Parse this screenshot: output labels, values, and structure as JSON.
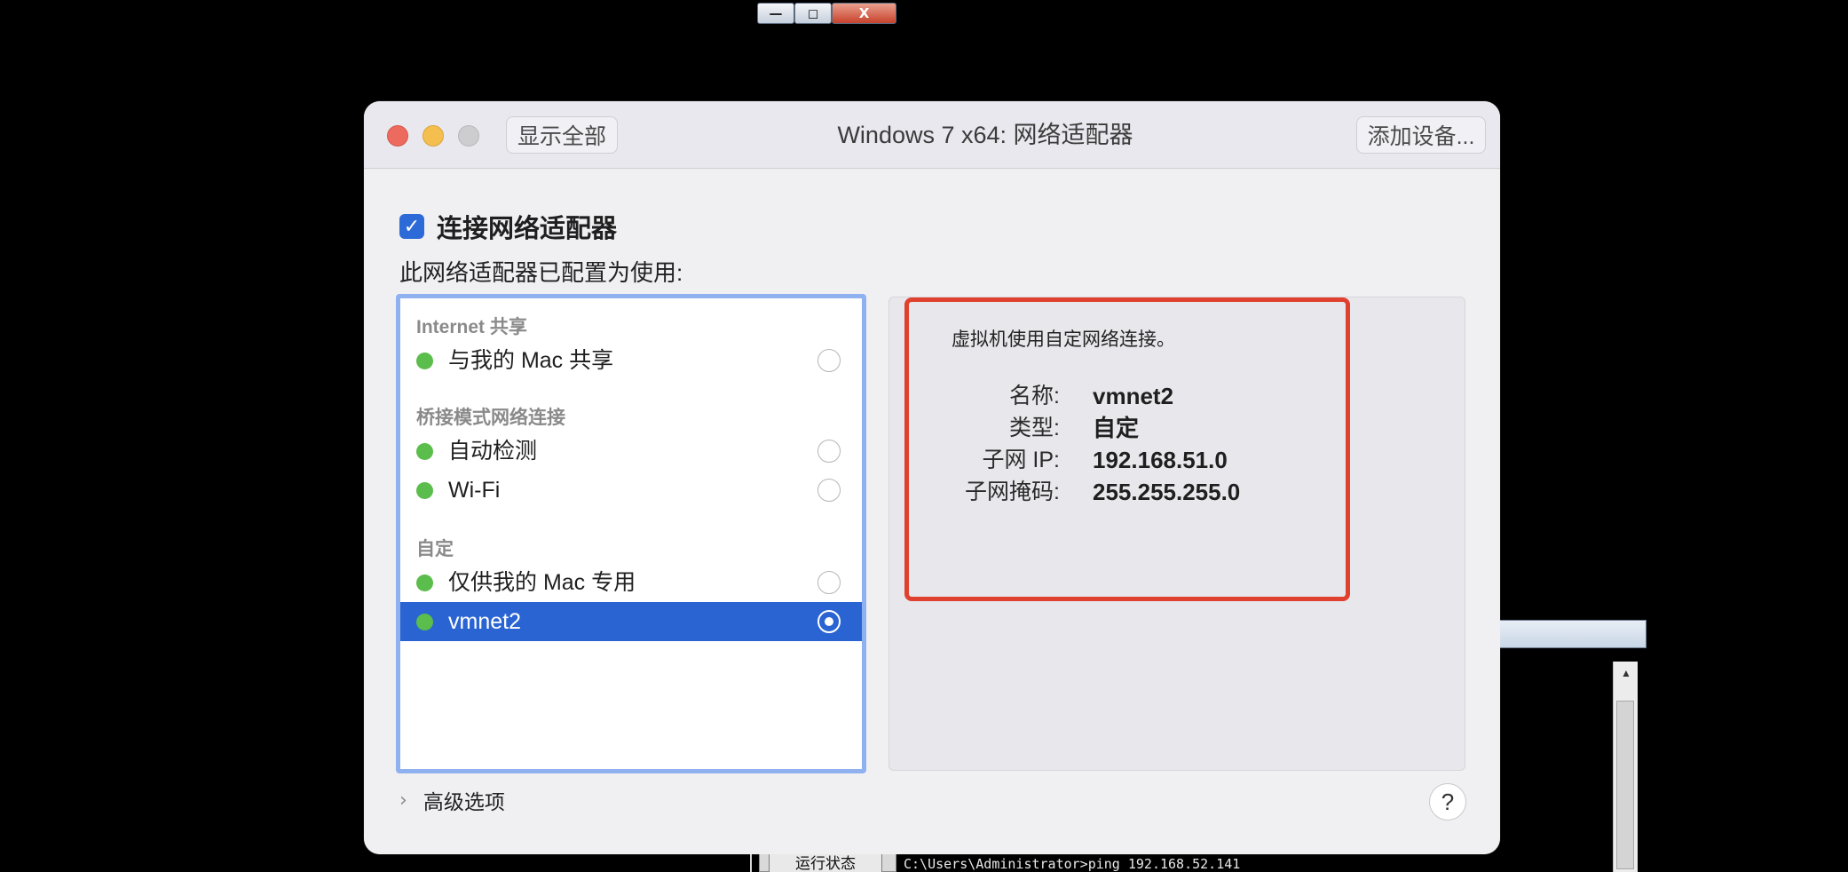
{
  "background_window": {
    "minimize_glyph": "—",
    "maximize_glyph": "◻",
    "close_glyph": "X",
    "side_button_label": "运行状态",
    "cmd_line": "C:\\Users\\Administrator>ping 192.168.52.141"
  },
  "dialog": {
    "title": "Windows 7 x64: 网络适配器",
    "show_all_label": "显示全部",
    "add_device_label": "添加设备...",
    "connect_checkbox_label": "连接网络适配器",
    "connect_checked": true,
    "config_label": "此网络适配器已配置为使用:",
    "groups": [
      {
        "header": "Internet 共享",
        "items": [
          {
            "label": "与我的 Mac 共享",
            "selected": false
          }
        ]
      },
      {
        "header": "桥接模式网络连接",
        "items": [
          {
            "label": "自动检测",
            "selected": false
          },
          {
            "label": "Wi-Fi",
            "selected": false
          }
        ]
      },
      {
        "header": "自定",
        "items": [
          {
            "label": "仅供我的 Mac 专用",
            "selected": false
          },
          {
            "label": "vmnet2",
            "selected": true
          }
        ]
      }
    ],
    "details": {
      "description": "虚拟机使用自定网络连接。",
      "name_key": "名称:",
      "name_value": "vmnet2",
      "type_key": "类型:",
      "type_value": "自定",
      "subnet_ip_key": "子网 IP:",
      "subnet_ip_value": "192.168.51.0",
      "subnet_mask_key": "子网掩码:",
      "subnet_mask_value": "255.255.255.0"
    },
    "advanced_label": "高级选项",
    "help_label": "?"
  },
  "colors": {
    "accent": "#2a64d3",
    "status_dot": "#5bbd4b",
    "highlight_border": "#e0412f"
  }
}
